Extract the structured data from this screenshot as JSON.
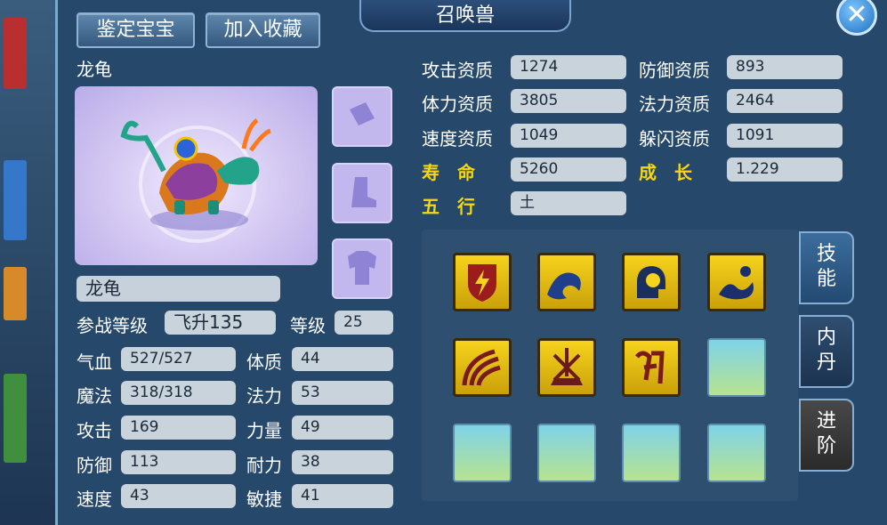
{
  "window": {
    "title": "召唤兽",
    "close": "✕"
  },
  "buttons": {
    "appraise": "鉴定宝宝",
    "favorite": "加入收藏"
  },
  "pet": {
    "species": "龙龟",
    "name": "龙龟",
    "battle_level_label": "参战等级",
    "battle_level": "飞升135",
    "level_label": "等级",
    "level": "25"
  },
  "aptitudes": {
    "attack": {
      "label": "攻击资质",
      "value": "1274"
    },
    "defense": {
      "label": "防御资质",
      "value": "893"
    },
    "stamina": {
      "label": "体力资质",
      "value": "3805"
    },
    "magic": {
      "label": "法力资质",
      "value": "2464"
    },
    "speed": {
      "label": "速度资质",
      "value": "1049"
    },
    "dodge": {
      "label": "躲闪资质",
      "value": "1091"
    },
    "life": {
      "label": "寿　命",
      "value": "5260"
    },
    "growth": {
      "label": "成　长",
      "value": "1.229"
    },
    "element": {
      "label": "五　行",
      "value": "土"
    }
  },
  "stats": {
    "hp": {
      "label": "气血",
      "value": "527/527"
    },
    "mp": {
      "label": "魔法",
      "value": "318/318"
    },
    "atk": {
      "label": "攻击",
      "value": "169"
    },
    "def": {
      "label": "防御",
      "value": "113"
    },
    "spd": {
      "label": "速度",
      "value": "43"
    },
    "con": {
      "label": "体质",
      "value": "44"
    },
    "mag": {
      "label": "法力",
      "value": "53"
    },
    "str": {
      "label": "力量",
      "value": "49"
    },
    "end": {
      "label": "耐力",
      "value": "38"
    },
    "agi": {
      "label": "敏捷",
      "value": "41"
    }
  },
  "tabs": {
    "skills": "技能",
    "inner_core": "内丹",
    "advance": "进阶"
  },
  "skill_icons": [
    "shield-lightning-icon",
    "wave-icon",
    "mind-head-icon",
    "swirl-creature-icon",
    "claw-scratch-icon",
    "weapons-icon",
    "rune-icon"
  ],
  "colors": {
    "accent_yellow": "#f6d60f",
    "skill_gold": "#f6d31c"
  }
}
